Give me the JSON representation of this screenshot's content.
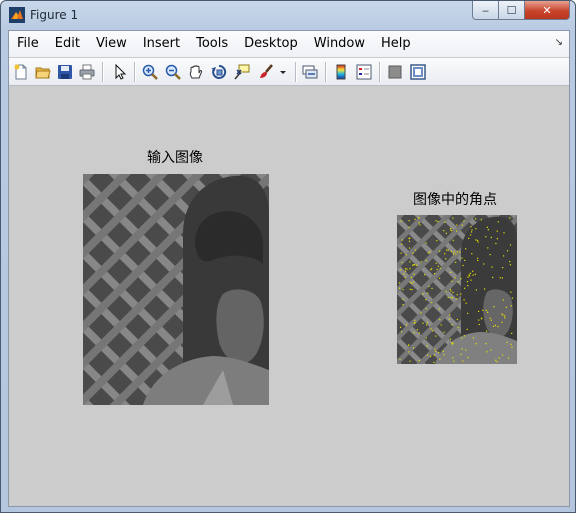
{
  "window": {
    "title": "Figure 1",
    "controls": {
      "minimize": "‒",
      "maximize": "☐",
      "close": "✕"
    }
  },
  "menu": {
    "items": [
      "File",
      "Edit",
      "View",
      "Insert",
      "Tools",
      "Desktop",
      "Window",
      "Help"
    ],
    "overflow_icon": "dock-arrow-icon"
  },
  "toolbar": {
    "buttons": [
      "new-figure-icon",
      "open-file-icon",
      "save-icon",
      "print-icon",
      "select-arrow-icon",
      "zoom-in-icon",
      "zoom-out-icon",
      "pan-hand-icon",
      "rotate-3d-icon",
      "data-cursor-icon",
      "brush-icon",
      "link-plot-icon",
      "colorbar-icon",
      "legend-icon",
      "hide-plot-tools-icon",
      "show-plot-tools-icon"
    ]
  },
  "axes": [
    {
      "title": "输入图像",
      "content": "grayscale photo of a boy in front of a lattice fence"
    },
    {
      "title": "图像中的角点",
      "content": "same photo, smaller, overlaid with yellow corner-point markers"
    }
  ],
  "colors": {
    "figure_background": "#cccccc",
    "corner_marker": "#e8e000",
    "close_button": "#c8452c"
  }
}
